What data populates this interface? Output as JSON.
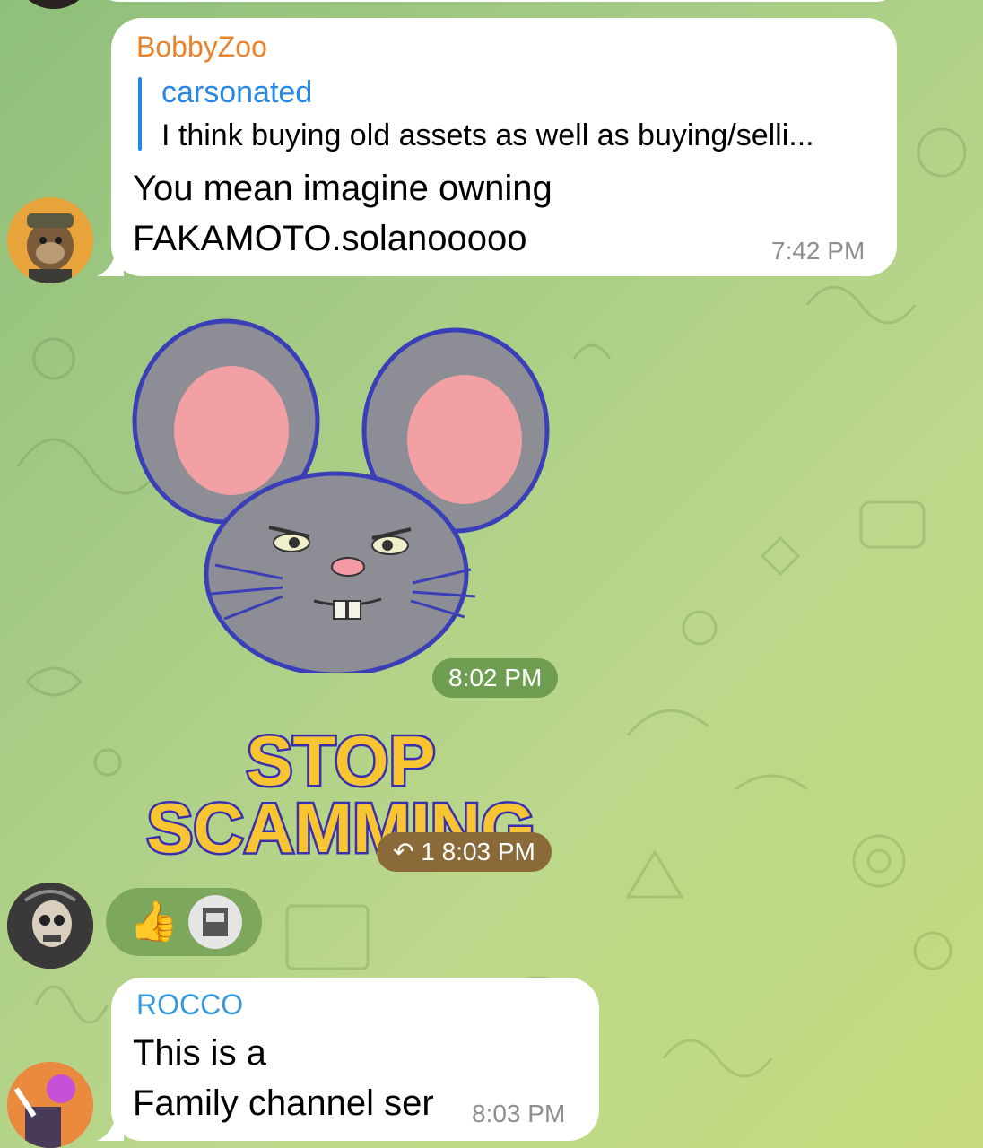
{
  "messages": [
    {
      "sender": "BobbyZoo",
      "sender_color": "#e8832b",
      "reply": {
        "name": "carsonated",
        "text": "I think buying old assets as well as buying/selli..."
      },
      "lines": [
        "You mean imagine owning",
        "FAKAMOTO.solanooooo"
      ],
      "time": "7:42 PM"
    },
    {
      "type": "sticker",
      "sticker": "mouse-sticker",
      "time": "8:02 PM"
    },
    {
      "type": "sticker",
      "sticker_lines": [
        "STOP",
        "SCAMMING"
      ],
      "reply_count": "1",
      "time": "8:03 PM",
      "reactions": [
        "👍"
      ]
    },
    {
      "sender": "ROCCO",
      "sender_color": "#3a9ad9",
      "lines": [
        "This is a",
        "Family channel ser"
      ],
      "time": "8:03 PM"
    }
  ],
  "colors": {
    "bubble": "#ffffff",
    "time_pill_green": "#6f9e52",
    "time_pill_brown": "#8a6a38",
    "reply_accent": "#2787e3"
  }
}
